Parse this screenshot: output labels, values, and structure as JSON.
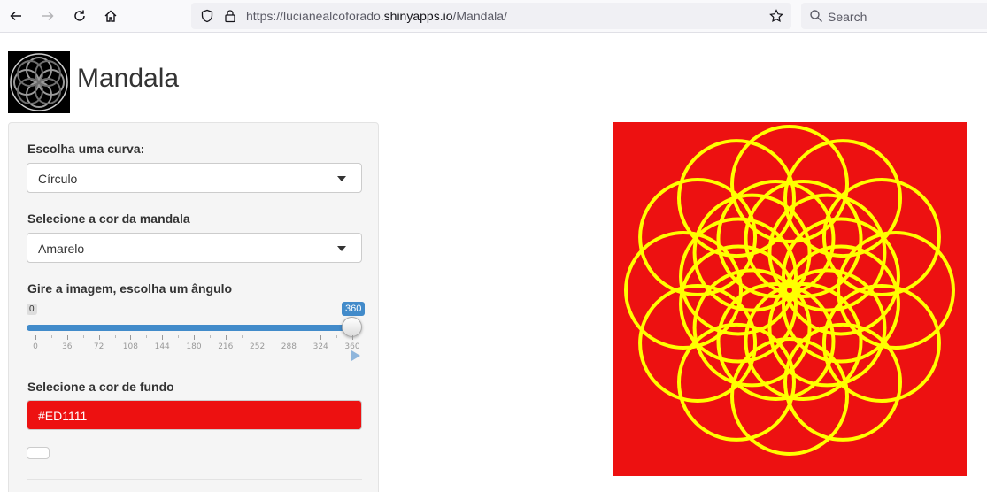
{
  "browser": {
    "url_prefix": "https://lucianealcoforado.",
    "url_host": "shinyapps.io",
    "url_path": "/Mandala/",
    "search_placeholder": "Search"
  },
  "app": {
    "title": "Mandala"
  },
  "controls": {
    "curve_label": "Escolha uma curva:",
    "curve_value": "Círculo",
    "color_label": "Selecione a cor da mandala",
    "color_value": "Amarelo",
    "angle_label": "Gire a imagem, escolha um ângulo",
    "angle_min": "0",
    "angle_max": "360",
    "angle_value": 360,
    "angle_ticks": [
      "0",
      "36",
      "72",
      "108",
      "144",
      "180",
      "216",
      "252",
      "288",
      "324",
      "360"
    ],
    "bg_label": "Selecione a cor de fundo",
    "bg_value": "#ED1111"
  },
  "plot": {
    "background": "#ED1111",
    "line_color": "#FFFF00"
  }
}
